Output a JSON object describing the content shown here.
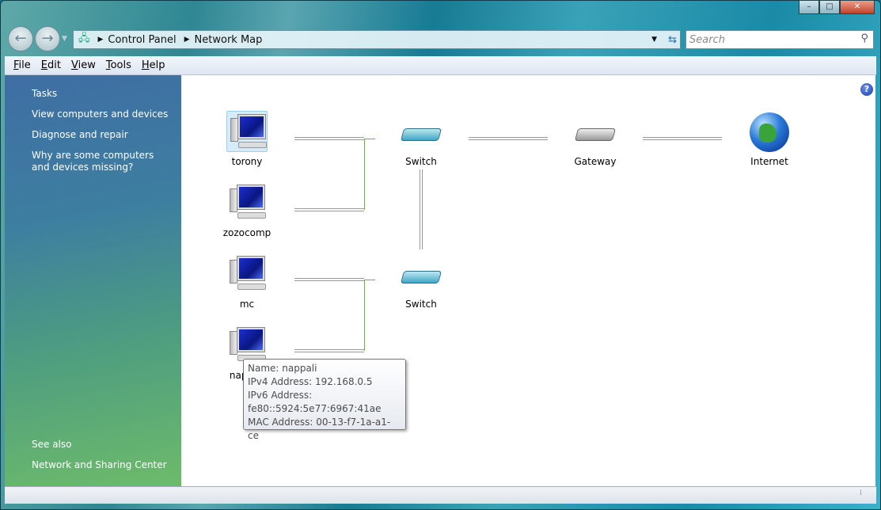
{
  "window": {
    "minimize": "–",
    "maximize": "□",
    "close": "✕"
  },
  "address": {
    "crumbs": [
      "Control Panel",
      "Network Map"
    ]
  },
  "search": {
    "placeholder": "Search"
  },
  "menu": [
    "File",
    "Edit",
    "View",
    "Tools",
    "Help"
  ],
  "sidebar": {
    "tasks_heading": "Tasks",
    "tasks": [
      "View computers and devices",
      "Diagnose and repair",
      "Why are some computers and devices missing?"
    ],
    "see_also_heading": "See also",
    "see_also": [
      "Network and Sharing Center"
    ]
  },
  "help": "?",
  "nodes": {
    "computers": [
      "torony",
      "zozocomp",
      "mc",
      "nappali"
    ],
    "switch1": "Switch",
    "switch2": "Switch",
    "gateway": "Gateway",
    "internet": "Internet"
  },
  "tooltip": {
    "lines": [
      "Name: nappali",
      "IPv4 Address: 192.168.0.5",
      "IPv6 Address:",
      "fe80::5924:5e77:6967:41ae",
      "MAC Address: 00-13-f7-1a-a1-ce"
    ]
  }
}
